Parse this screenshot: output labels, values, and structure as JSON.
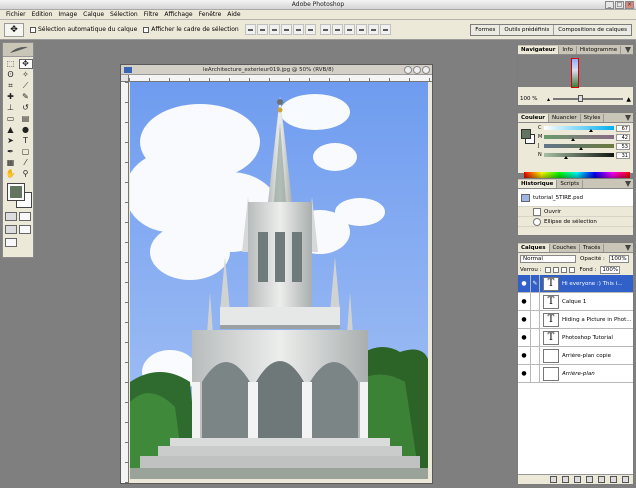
{
  "app": {
    "title": "Adobe Photoshop"
  },
  "menu": [
    "Fichier",
    "Edition",
    "Image",
    "Calque",
    "Sélection",
    "Filtre",
    "Affichage",
    "Fenêtre",
    "Aide"
  ],
  "options": {
    "auto_select": "Sélection automatique du calque",
    "show_bounds": "Afficher le cadre de sélection"
  },
  "palette_well": [
    "Formes",
    "Outils prédéfinis",
    "Compositions de calques"
  ],
  "document": {
    "title": "leArchitecture_exterieur019.jpg @ 50% (RVB/8)"
  },
  "navigator": {
    "tabs": [
      "Navigateur",
      "Info",
      "Histogramme"
    ],
    "zoom": "100 %",
    "zoom_level": 0.35
  },
  "color_panel": {
    "tabs": [
      "Couleur",
      "Nuancier",
      "Styles"
    ],
    "channels": [
      {
        "label": "C",
        "value": "67",
        "pos": 0.67
      },
      {
        "label": "M",
        "value": "42",
        "pos": 0.42
      },
      {
        "label": "J",
        "value": "53",
        "pos": 0.53
      },
      {
        "label": "N",
        "value": "31",
        "pos": 0.31
      }
    ],
    "foreground": "#627560",
    "background": "#ffffff"
  },
  "history": {
    "tabs": [
      "Historique",
      "Scripts"
    ],
    "snapshot": "tutorial_5TIRE.psd",
    "steps": [
      "Ouvrir",
      "Ellipse de sélection"
    ]
  },
  "layers": {
    "tabs": [
      "Calques",
      "Couches",
      "Tracés"
    ],
    "mode": "Normal",
    "opacity_label": "Opacité :",
    "opacity": "100%",
    "lock_label": "Verrou :",
    "fill_label": "Fond :",
    "fill": "100%",
    "items": [
      {
        "name": "Hi everyone :) This i...",
        "type": "text",
        "selected": true
      },
      {
        "name": "Calque 1",
        "type": "text",
        "selected": false
      },
      {
        "name": "Hiding a Picture in Phot...",
        "type": "text",
        "selected": false
      },
      {
        "name": "Photoshop Tutorial",
        "type": "text",
        "selected": false
      },
      {
        "name": "Arrière-plan copie",
        "type": "image",
        "selected": false
      },
      {
        "name": "Arrière-plan",
        "type": "image",
        "selected": false
      }
    ]
  },
  "icons": {
    "text_layer_thumb": "T",
    "eye": "●",
    "brush_link": "✎"
  }
}
